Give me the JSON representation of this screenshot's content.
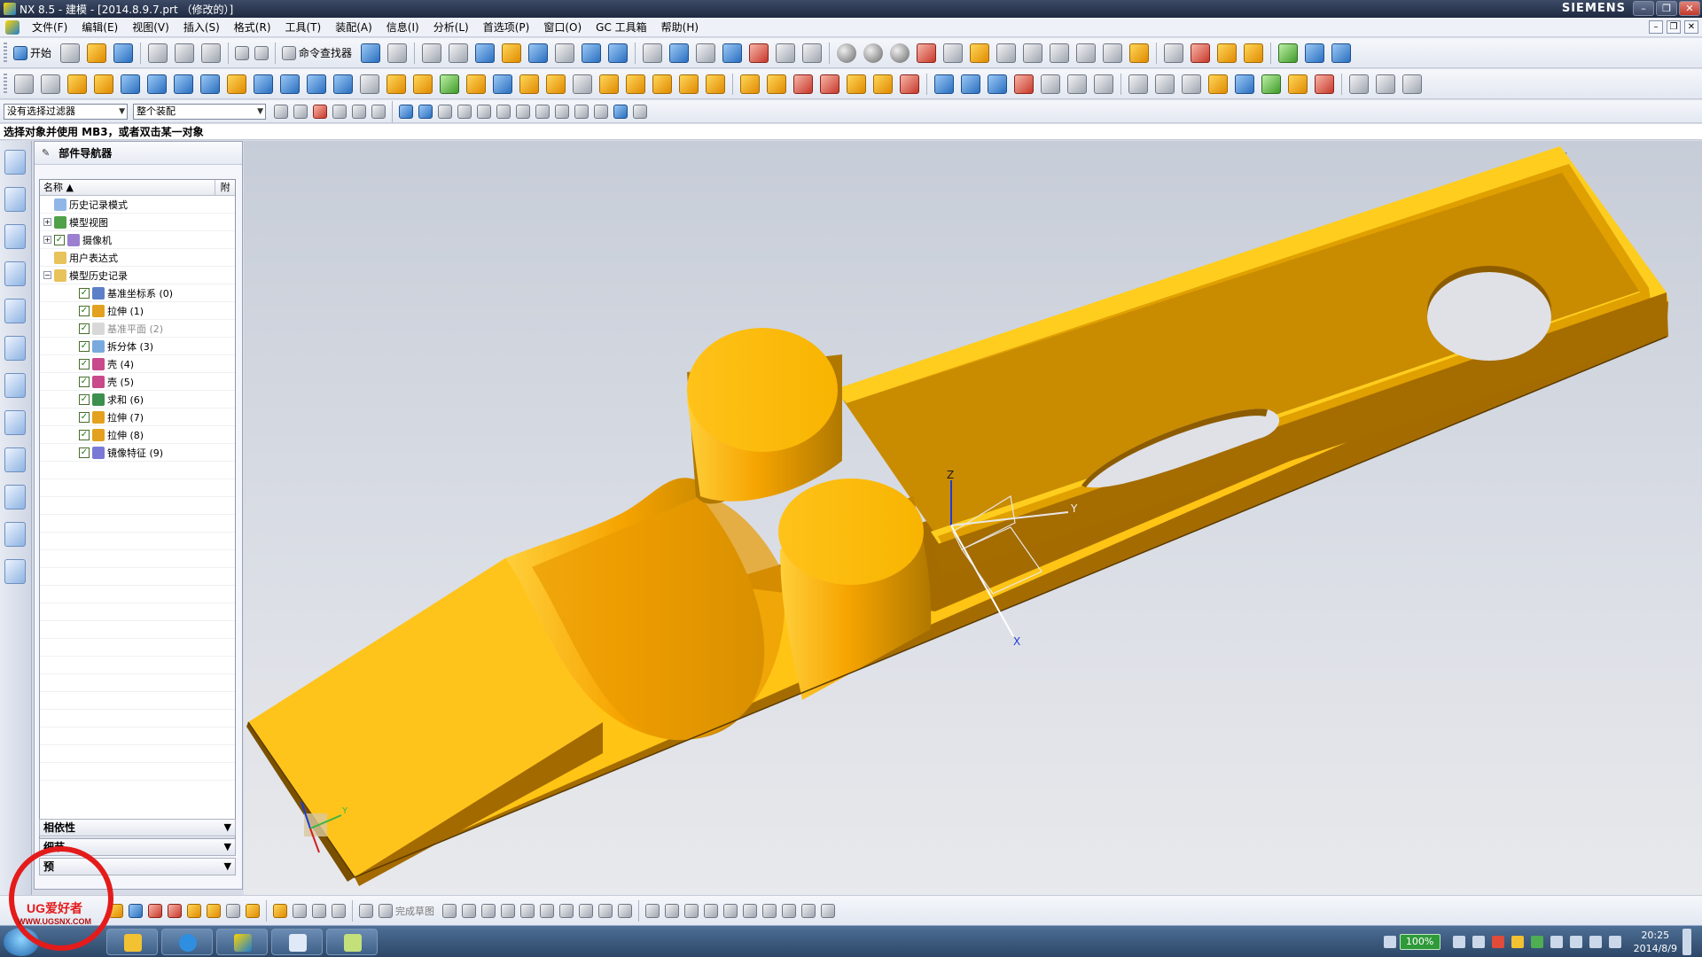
{
  "window": {
    "title": "NX 8.5 - 建模 - [2014.8.9.7.prt （修改的）]",
    "brand": "SIEMENS"
  },
  "menu": [
    "文件(F)",
    "编辑(E)",
    "视图(V)",
    "插入(S)",
    "格式(R)",
    "工具(T)",
    "装配(A)",
    "信息(I)",
    "分析(L)",
    "首选项(P)",
    "窗口(O)",
    "GC 工具箱",
    "帮助(H)"
  ],
  "toolbar": {
    "start_label": "开始",
    "command_finder": "命令查找器",
    "filter_value": "没有选择过滤器",
    "scope_value": "整个装配"
  },
  "cue_line": "选择对象并使用 MB3，或者双击某一对象",
  "navigator": {
    "title": "部件导航器",
    "col_name": "名称",
    "col_extra": "附",
    "items": [
      {
        "label": "历史记录模式",
        "level": 0,
        "expand": "",
        "check": false,
        "icon": "clock",
        "dim": false
      },
      {
        "label": "模型视图",
        "level": 0,
        "expand": "+",
        "check": false,
        "icon": "views",
        "dim": false
      },
      {
        "label": "摄像机",
        "level": 0,
        "expand": "+",
        "check": true,
        "icon": "camera",
        "dim": false
      },
      {
        "label": "用户表达式",
        "level": 0,
        "expand": "",
        "check": false,
        "icon": "folder",
        "dim": false
      },
      {
        "label": "模型历史记录",
        "level": 0,
        "expand": "−",
        "check": false,
        "icon": "folder",
        "dim": false
      },
      {
        "label": "基准坐标系 (0)",
        "level": 1,
        "expand": "",
        "check": true,
        "icon": "csys",
        "dim": false
      },
      {
        "label": "拉伸 (1)",
        "level": 1,
        "expand": "",
        "check": true,
        "icon": "extrude",
        "dim": false
      },
      {
        "label": "基准平面 (2)",
        "level": 1,
        "expand": "",
        "check": true,
        "icon": "plane",
        "dim": true
      },
      {
        "label": "拆分体 (3)",
        "level": 1,
        "expand": "",
        "check": true,
        "icon": "split",
        "dim": false
      },
      {
        "label": "壳 (4)",
        "level": 1,
        "expand": "",
        "check": true,
        "icon": "shell",
        "dim": false
      },
      {
        "label": "壳 (5)",
        "level": 1,
        "expand": "",
        "check": true,
        "icon": "shell",
        "dim": false
      },
      {
        "label": "求和 (6)",
        "level": 1,
        "expand": "",
        "check": true,
        "icon": "unite",
        "dim": false
      },
      {
        "label": "拉伸 (7)",
        "level": 1,
        "expand": "",
        "check": true,
        "icon": "extrude",
        "dim": false
      },
      {
        "label": "拉伸 (8)",
        "level": 1,
        "expand": "",
        "check": true,
        "icon": "extrude",
        "dim": false
      },
      {
        "label": "镜像特征 (9)",
        "level": 1,
        "expand": "",
        "check": true,
        "icon": "mirror",
        "dim": false
      }
    ],
    "sections": [
      "相依性",
      "细节",
      "预"
    ]
  },
  "viewport": {
    "triad_labels": [
      "Z",
      "Y",
      "X"
    ],
    "mini_triad_label": "Y",
    "model_color": "#f5a800",
    "model_shadow": "#8f5f00"
  },
  "bottom_toolbar": {
    "finish_sketch": "完成草图"
  },
  "taskbar": {
    "zoom": "100%",
    "time": "20:25",
    "date": "2014/8/9"
  },
  "watermark": {
    "text": "UG爱好者",
    "url": "WWW.UGSNX.COM"
  }
}
